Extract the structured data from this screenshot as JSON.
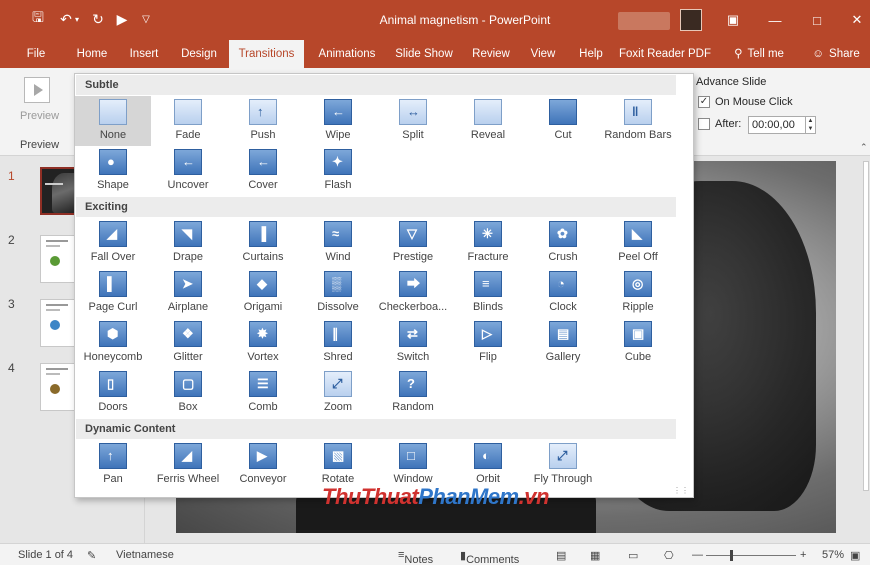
{
  "window": {
    "title": "Animal magnetism - PowerPoint"
  },
  "tabs": [
    {
      "label": "File"
    },
    {
      "label": "Home"
    },
    {
      "label": "Insert"
    },
    {
      "label": "Design"
    },
    {
      "label": "Transitions"
    },
    {
      "label": "Animations"
    },
    {
      "label": "Slide Show"
    },
    {
      "label": "Review"
    },
    {
      "label": "View"
    },
    {
      "label": "Help"
    },
    {
      "label": "Foxit Reader PDF"
    },
    {
      "label": "Tell me"
    },
    {
      "label": "Share"
    }
  ],
  "ribbon": {
    "preview_label": "Preview",
    "preview_group": "Preview",
    "advance_title": "Advance Slide",
    "on_mouse_click": "On Mouse Click",
    "after_label": "After:",
    "after_value": "00:00,00"
  },
  "gallery": {
    "sections": [
      {
        "title": "Subtle",
        "items": [
          {
            "label": "None",
            "icon": "none-icon"
          },
          {
            "label": "Fade",
            "icon": "fade-icon"
          },
          {
            "label": "Push",
            "icon": "push-icon"
          },
          {
            "label": "Wipe",
            "icon": "wipe-icon"
          },
          {
            "label": "Split",
            "icon": "split-icon"
          },
          {
            "label": "Reveal",
            "icon": "reveal-icon"
          },
          {
            "label": "Cut",
            "icon": "cut-icon"
          },
          {
            "label": "Random Bars",
            "icon": "random-bars-icon"
          },
          {
            "label": "Shape",
            "icon": "shape-icon"
          },
          {
            "label": "Uncover",
            "icon": "uncover-icon"
          },
          {
            "label": "Cover",
            "icon": "cover-icon"
          },
          {
            "label": "Flash",
            "icon": "flash-icon"
          }
        ]
      },
      {
        "title": "Exciting",
        "items": [
          {
            "label": "Fall Over",
            "icon": "fall-over-icon"
          },
          {
            "label": "Drape",
            "icon": "drape-icon"
          },
          {
            "label": "Curtains",
            "icon": "curtains-icon"
          },
          {
            "label": "Wind",
            "icon": "wind-icon"
          },
          {
            "label": "Prestige",
            "icon": "prestige-icon"
          },
          {
            "label": "Fracture",
            "icon": "fracture-icon"
          },
          {
            "label": "Crush",
            "icon": "crush-icon"
          },
          {
            "label": "Peel Off",
            "icon": "peel-off-icon"
          },
          {
            "label": "Page Curl",
            "icon": "page-curl-icon"
          },
          {
            "label": "Airplane",
            "icon": "airplane-icon"
          },
          {
            "label": "Origami",
            "icon": "origami-icon"
          },
          {
            "label": "Dissolve",
            "icon": "dissolve-icon"
          },
          {
            "label": "Checkerboa...",
            "icon": "checkerboard-icon"
          },
          {
            "label": "Blinds",
            "icon": "blinds-icon"
          },
          {
            "label": "Clock",
            "icon": "clock-icon"
          },
          {
            "label": "Ripple",
            "icon": "ripple-icon"
          },
          {
            "label": "Honeycomb",
            "icon": "honeycomb-icon"
          },
          {
            "label": "Glitter",
            "icon": "glitter-icon"
          },
          {
            "label": "Vortex",
            "icon": "vortex-icon"
          },
          {
            "label": "Shred",
            "icon": "shred-icon"
          },
          {
            "label": "Switch",
            "icon": "switch-icon"
          },
          {
            "label": "Flip",
            "icon": "flip-icon"
          },
          {
            "label": "Gallery",
            "icon": "gallery-icon"
          },
          {
            "label": "Cube",
            "icon": "cube-icon"
          },
          {
            "label": "Doors",
            "icon": "doors-icon"
          },
          {
            "label": "Box",
            "icon": "box-icon"
          },
          {
            "label": "Comb",
            "icon": "comb-icon"
          },
          {
            "label": "Zoom",
            "icon": "zoom-icon"
          },
          {
            "label": "Random",
            "icon": "random-icon"
          }
        ]
      },
      {
        "title": "Dynamic Content",
        "items": [
          {
            "label": "Pan",
            "icon": "pan-icon"
          },
          {
            "label": "Ferris Wheel",
            "icon": "ferris-wheel-icon"
          },
          {
            "label": "Conveyor",
            "icon": "conveyor-icon"
          },
          {
            "label": "Rotate",
            "icon": "rotate-icon"
          },
          {
            "label": "Window",
            "icon": "window-icon"
          },
          {
            "label": "Orbit",
            "icon": "orbit-icon"
          },
          {
            "label": "Fly Through",
            "icon": "fly-through-icon"
          }
        ]
      }
    ]
  },
  "slides": [
    {
      "number": "1",
      "active": true
    },
    {
      "number": "2"
    },
    {
      "number": "3"
    },
    {
      "number": "4"
    }
  ],
  "statusbar": {
    "slide_info": "Slide 1 of 4",
    "language": "Vietnamese",
    "notes": "Notes",
    "comments": "Comments",
    "zoom": "57%"
  },
  "watermark": {
    "part1": "ThuThuat",
    "part2": "PhanMem",
    "part3": ".vn"
  },
  "colors": {
    "accent": "#b7472a",
    "icon_blue": "#3f74b9"
  }
}
